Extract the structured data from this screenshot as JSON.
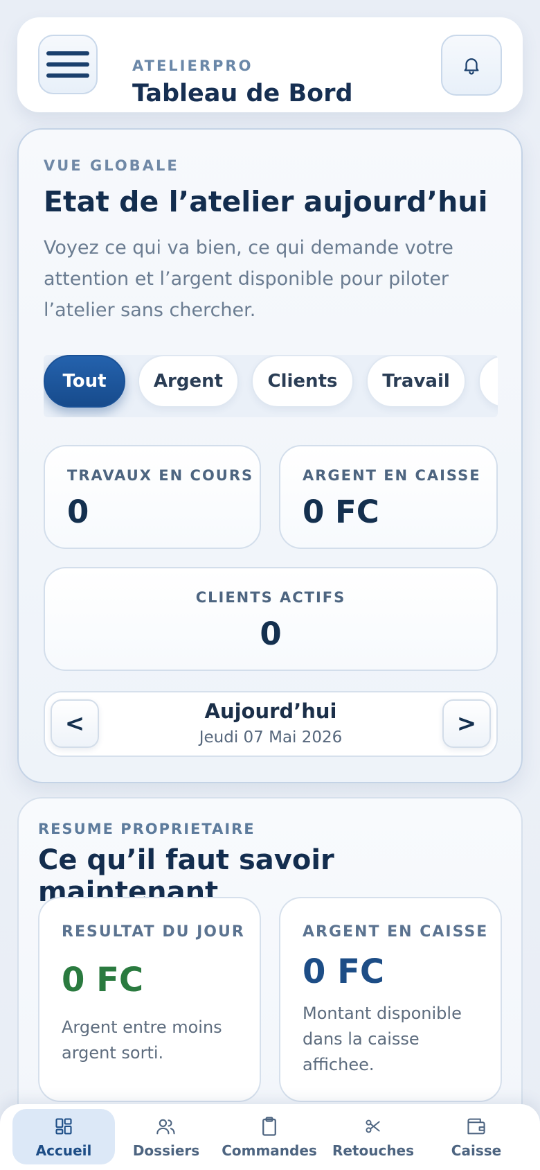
{
  "header": {
    "brand": "ATELIERPRO",
    "title": "Tableau de Bord"
  },
  "overview": {
    "eyebrow": "VUE GLOBALE",
    "title": "Etat de l’atelier aujourd’hui",
    "description": "Voyez ce qui va bien, ce qui demande votre attention et l’argent disponible pour piloter l’atelier sans chercher.",
    "filters": [
      "Tout",
      "Argent",
      "Clients",
      "Travail"
    ],
    "active_filter": "Tout",
    "stats": [
      {
        "label": "TRAVAUX EN COURS",
        "value": "0"
      },
      {
        "label": "ARGENT EN CAISSE",
        "value": "0 FC"
      },
      {
        "label": "CLIENTS ACTIFS",
        "value": "0"
      }
    ],
    "date": {
      "prev": "<",
      "next": ">",
      "title": "Aujourd’hui",
      "subtitle": "Jeudi 07 Mai 2026"
    }
  },
  "summary": {
    "eyebrow": "RESUME PROPRIETAIRE",
    "title": "Ce qu’il faut savoir maintenant",
    "cards": [
      {
        "label": "RESULTAT DU JOUR",
        "value": "0 FC",
        "note": "Argent entre moins argent sorti.",
        "value_color": "#2a7a3f"
      },
      {
        "label": "ARGENT EN CAISSE",
        "value": "0 FC",
        "note": "Montant disponible dans la caisse affichee.",
        "value_color": "#1d4d86"
      }
    ]
  },
  "bottom_nav": {
    "items": [
      {
        "label": "Accueil",
        "icon": "dashboard-icon"
      },
      {
        "label": "Dossiers",
        "icon": "users-icon"
      },
      {
        "label": "Commandes",
        "icon": "clipboard-icon"
      },
      {
        "label": "Retouches",
        "icon": "scissors-icon"
      },
      {
        "label": "Caisse",
        "icon": "wallet-icon"
      }
    ],
    "active": "Accueil"
  },
  "colors": {
    "primary": "#1d4d86",
    "accent_green": "#2a7a3f",
    "text_dark": "#14304f"
  }
}
